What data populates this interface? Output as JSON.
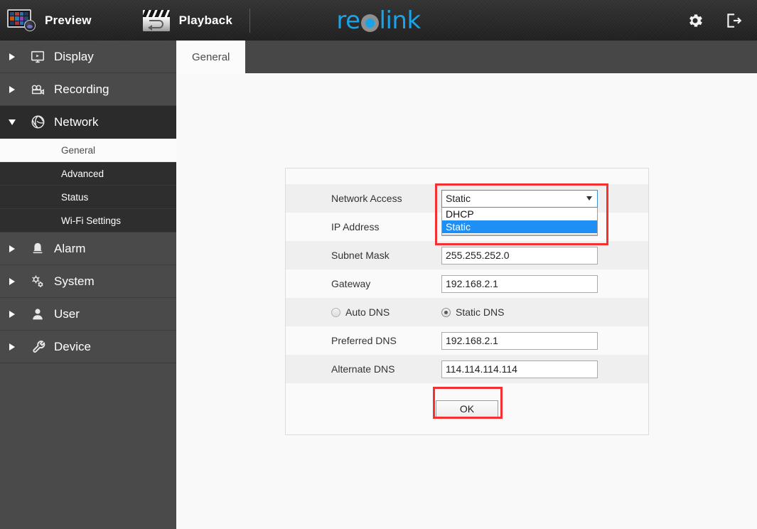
{
  "header": {
    "brand": {
      "prefix": "re",
      "suffix": "link",
      "accent": "#1ba3e8"
    },
    "nav": [
      {
        "id": "preview",
        "label": "Preview",
        "icon": "monitor-preview-icon"
      },
      {
        "id": "playback",
        "label": "Playback",
        "icon": "clapperboard-playback-icon"
      }
    ],
    "actions": [
      {
        "id": "settings",
        "icon": "gear-icon"
      },
      {
        "id": "logout",
        "icon": "logout-icon"
      }
    ]
  },
  "sidebar": {
    "items": [
      {
        "label": "Display",
        "icon": "monitor-icon",
        "expanded": false
      },
      {
        "label": "Recording",
        "icon": "videocam-icon",
        "expanded": false
      },
      {
        "label": "Network",
        "icon": "globe-icon",
        "expanded": true
      },
      {
        "label": "Alarm",
        "icon": "bell-icon",
        "expanded": false
      },
      {
        "label": "System",
        "icon": "gears-icon",
        "expanded": false
      },
      {
        "label": "User",
        "icon": "person-icon",
        "expanded": false
      },
      {
        "label": "Device",
        "icon": "wrench-icon",
        "expanded": false
      }
    ],
    "network_subitems": [
      {
        "label": "General",
        "active": true
      },
      {
        "label": "Advanced",
        "active": false
      },
      {
        "label": "Status",
        "active": false
      },
      {
        "label": "Wi-Fi Settings",
        "active": false
      }
    ]
  },
  "main": {
    "tabs": [
      {
        "label": "General",
        "active": true
      }
    ],
    "form": {
      "network_access": {
        "label": "Network Access",
        "value": "Static",
        "open": true,
        "options": [
          {
            "label": "DHCP",
            "selected": false
          },
          {
            "label": "Static",
            "selected": true
          }
        ]
      },
      "ip_address": {
        "label": "IP Address",
        "value": ""
      },
      "subnet_mask": {
        "label": "Subnet Mask",
        "value": "255.255.252.0"
      },
      "gateway": {
        "label": "Gateway",
        "value": "192.168.2.1"
      },
      "dns_mode": {
        "auto": {
          "label": "Auto DNS",
          "selected": false
        },
        "static": {
          "label": "Static DNS",
          "selected": true
        }
      },
      "preferred_dns": {
        "label": "Preferred DNS",
        "value": "192.168.2.1"
      },
      "alternate_dns": {
        "label": "Alternate DNS",
        "value": "114.114.114.114"
      },
      "ok_button": {
        "label": "OK"
      }
    }
  },
  "annotations": {
    "color": "#f43030"
  }
}
